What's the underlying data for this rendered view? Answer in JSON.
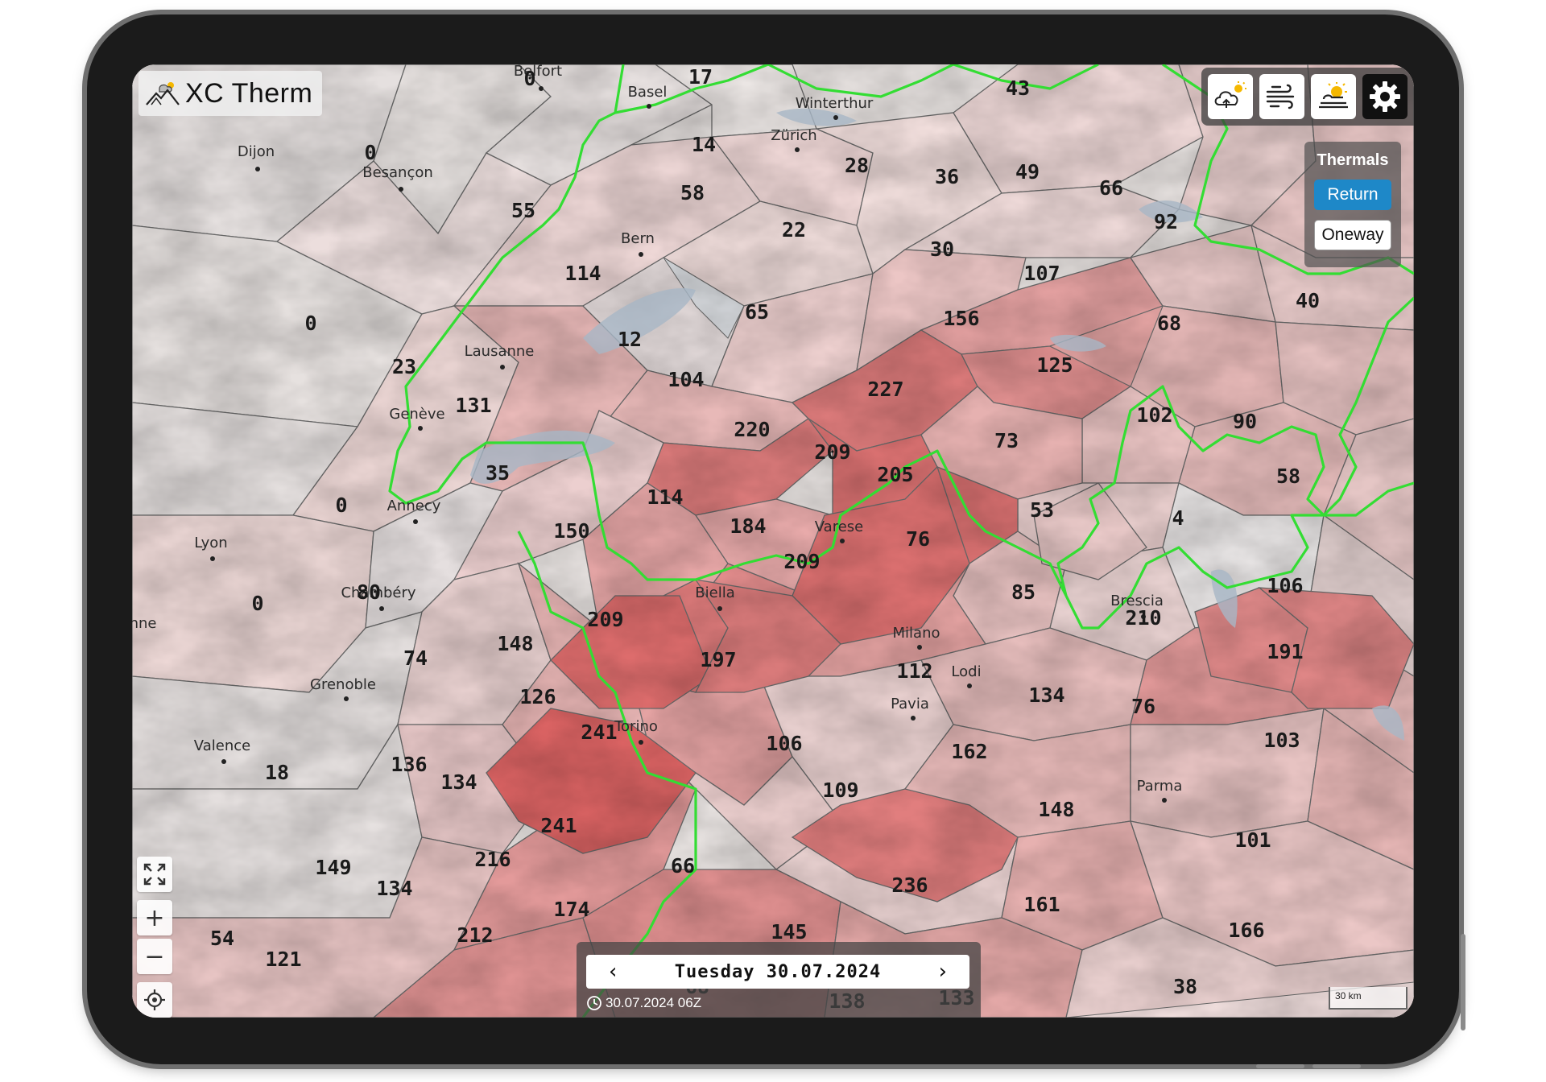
{
  "app": {
    "title": "XC Therm"
  },
  "toolbar": {
    "buttons": [
      {
        "name": "cloud-upload-sun-icon"
      },
      {
        "name": "wind-icon"
      },
      {
        "name": "sun-cloud-icon"
      },
      {
        "name": "gear-icon"
      }
    ]
  },
  "thermals_panel": {
    "title": "Thermals",
    "return_label": "Return",
    "oneway_label": "Oneway",
    "active_mode": "Return"
  },
  "controls": {
    "zoom_in": "+",
    "zoom_out": "−",
    "fullscreen_icon": "fullscreen-icon",
    "locate_icon": "crosshair-icon"
  },
  "date_nav": {
    "prev": "‹",
    "next": "›",
    "date_label": "Tuesday 30.07.2024",
    "run_label": "30.07.2024 06Z"
  },
  "scale_bar": {
    "label": "30 km"
  },
  "colors": {
    "border_line": "#33dd33",
    "low": "#e7e2e0",
    "high": "#dc5a5a",
    "active_button": "#1e88c8"
  },
  "cities": [
    {
      "name": "Belfort"
    },
    {
      "name": "Basel"
    },
    {
      "name": "Winterthur"
    },
    {
      "name": "Zürich"
    },
    {
      "name": "Dijon"
    },
    {
      "name": "Besançon"
    },
    {
      "name": "Bern"
    },
    {
      "name": "Lausanne"
    },
    {
      "name": "Genève"
    },
    {
      "name": "Annecy"
    },
    {
      "name": "Lyon"
    },
    {
      "name": "Chambéry"
    },
    {
      "name": "Grenoble"
    },
    {
      "name": "Valence"
    },
    {
      "name": "Biella"
    },
    {
      "name": "Varese"
    },
    {
      "name": "Milano"
    },
    {
      "name": "Lodi"
    },
    {
      "name": "Pavia"
    },
    {
      "name": "Torino"
    },
    {
      "name": "Brescia"
    },
    {
      "name": "Parma"
    },
    {
      "name": "enne"
    }
  ],
  "values": [
    {
      "v": 0
    },
    {
      "v": 17
    },
    {
      "v": 43
    },
    {
      "v": 0
    },
    {
      "v": 14
    },
    {
      "v": 28
    },
    {
      "v": 36
    },
    {
      "v": 49
    },
    {
      "v": 66
    },
    {
      "v": 58
    },
    {
      "v": 55
    },
    {
      "v": 22
    },
    {
      "v": 92
    },
    {
      "v": 30
    },
    {
      "v": 107
    },
    {
      "v": 114
    },
    {
      "v": 0
    },
    {
      "v": 65
    },
    {
      "v": 156
    },
    {
      "v": 68
    },
    {
      "v": 40
    },
    {
      "v": 12
    },
    {
      "v": 23
    },
    {
      "v": 104
    },
    {
      "v": 227
    },
    {
      "v": 125
    },
    {
      "v": 131
    },
    {
      "v": 220
    },
    {
      "v": 102
    },
    {
      "v": 90
    },
    {
      "v": 209
    },
    {
      "v": 73
    },
    {
      "v": 35
    },
    {
      "v": 205
    },
    {
      "v": 58
    },
    {
      "v": 114
    },
    {
      "v": 0
    },
    {
      "v": 53
    },
    {
      "v": 4
    },
    {
      "v": 184
    },
    {
      "v": 150
    },
    {
      "v": 76
    },
    {
      "v": 209
    },
    {
      "v": 0
    },
    {
      "v": 80
    },
    {
      "v": 85
    },
    {
      "v": 106
    },
    {
      "v": 209
    },
    {
      "v": 210
    },
    {
      "v": 148
    },
    {
      "v": 191
    },
    {
      "v": 74
    },
    {
      "v": 197
    },
    {
      "v": 112
    },
    {
      "v": 134
    },
    {
      "v": 126
    },
    {
      "v": 76
    },
    {
      "v": 241
    },
    {
      "v": 106
    },
    {
      "v": 162
    },
    {
      "v": 103
    },
    {
      "v": 136
    },
    {
      "v": 18
    },
    {
      "v": 134
    },
    {
      "v": 109
    },
    {
      "v": 148
    },
    {
      "v": 241
    },
    {
      "v": 101
    },
    {
      "v": 149
    },
    {
      "v": 216
    },
    {
      "v": 66
    },
    {
      "v": 236
    },
    {
      "v": 134
    },
    {
      "v": 174
    },
    {
      "v": 161
    },
    {
      "v": 54
    },
    {
      "v": 212
    },
    {
      "v": 145
    },
    {
      "v": 166
    },
    {
      "v": 121
    },
    {
      "v": 38
    },
    {
      "v": 138
    },
    {
      "v": 133
    },
    {
      "v": 68
    }
  ]
}
